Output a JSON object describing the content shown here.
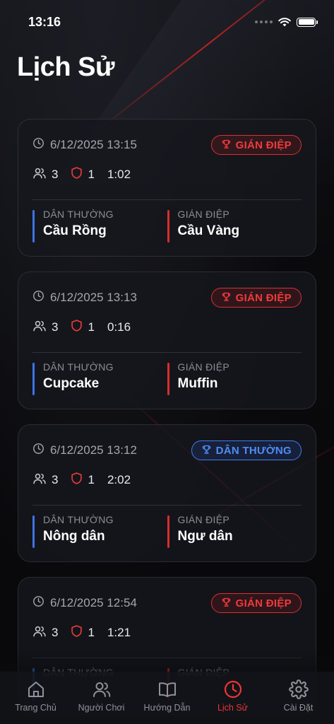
{
  "status_bar": {
    "time": "13:16"
  },
  "page": {
    "title": "Lịch Sử"
  },
  "colors": {
    "spy": "#ef3b3b",
    "civilian": "#4f8cf7",
    "accent": "#ef3535"
  },
  "history": [
    {
      "datetime": "6/12/2025 13:15",
      "winner": "GIÁN ĐIỆP",
      "winner_type": "spy",
      "players": "3",
      "spies": "1",
      "duration": "1:02",
      "civilian_label": "DÂN THƯỜNG",
      "civilian_word": "Cầu Rồng",
      "spy_label": "GIÁN ĐIỆP",
      "spy_word": "Cầu Vàng"
    },
    {
      "datetime": "6/12/2025 13:13",
      "winner": "GIÁN ĐIỆP",
      "winner_type": "spy",
      "players": "3",
      "spies": "1",
      "duration": "0:16",
      "civilian_label": "DÂN THƯỜNG",
      "civilian_word": "Cupcake",
      "spy_label": "GIÁN ĐIỆP",
      "spy_word": "Muffin"
    },
    {
      "datetime": "6/12/2025 13:12",
      "winner": "DÂN THƯỜNG",
      "winner_type": "civilian",
      "players": "3",
      "spies": "1",
      "duration": "2:02",
      "civilian_label": "DÂN THƯỜNG",
      "civilian_word": "Nông dân",
      "spy_label": "GIÁN ĐIỆP",
      "spy_word": "Ngư dân"
    },
    {
      "datetime": "6/12/2025 12:54",
      "winner": "GIÁN ĐIỆP",
      "winner_type": "spy",
      "players": "3",
      "spies": "1",
      "duration": "1:21",
      "civilian_label": "DÂN THƯỜNG",
      "civilian_word": "",
      "spy_label": "GIÁN ĐIỆP",
      "spy_word": ""
    }
  ],
  "tabs": [
    {
      "label": "Trang Chủ",
      "icon": "home-icon",
      "active": false
    },
    {
      "label": "Người Chơi",
      "icon": "users-icon",
      "active": false
    },
    {
      "label": "Hướng Dẫn",
      "icon": "book-icon",
      "active": false
    },
    {
      "label": "Lịch Sử",
      "icon": "clock-icon",
      "active": true
    },
    {
      "label": "Cài Đặt",
      "icon": "gear-icon",
      "active": false
    }
  ]
}
